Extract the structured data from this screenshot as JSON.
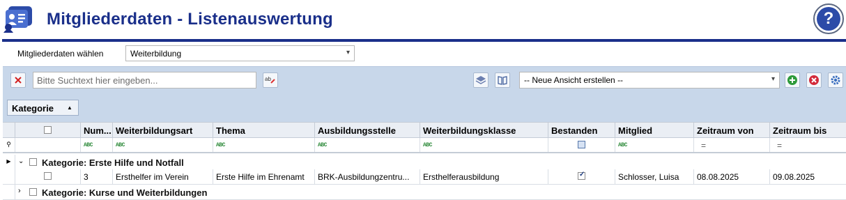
{
  "header": {
    "title": "Mitgliederdaten - Listenauswertung",
    "help_glyph": "?"
  },
  "selector": {
    "label": "Mitgliederdaten wählen",
    "value": "Weiterbildung"
  },
  "toolbar": {
    "search_placeholder": "Bitte Suchtext hier eingeben...",
    "search_value": "",
    "view_value": "-- Neue Ansicht erstellen --"
  },
  "group_panel": {
    "chip_label": "Kategorie"
  },
  "grid": {
    "columns": [
      "Num...",
      "Weiterbildungsart",
      "Thema",
      "Ausbildungsstelle",
      "Weiterbildungsklasse",
      "Bestanden",
      "Mitglied",
      "Zeitraum von",
      "Zeitraum bis"
    ],
    "filter_abc": "ABC",
    "filter_eq": "=",
    "groups": [
      {
        "label": "Kategorie: Erste Hilfe und Notfall",
        "expanded": true,
        "rows": [
          {
            "num": "3",
            "weiterbildungsart": "Ersthelfer im Verein",
            "thema": "Erste Hilfe im Ehrenamt",
            "ausbildungsstelle": "BRK-Ausbildungzentru...",
            "weiterbildungsklasse": "Ersthelferausbildung",
            "bestanden": true,
            "mitglied": "Schlosser, Luisa",
            "von": "08.08.2025",
            "bis": "09.08.2025"
          }
        ]
      },
      {
        "label": "Kategorie: Kurse und Weiterbildungen",
        "expanded": false,
        "rows": []
      }
    ]
  },
  "colors": {
    "brand": "#1a2f8a",
    "toolbar_bg": "#c8d7ea"
  }
}
